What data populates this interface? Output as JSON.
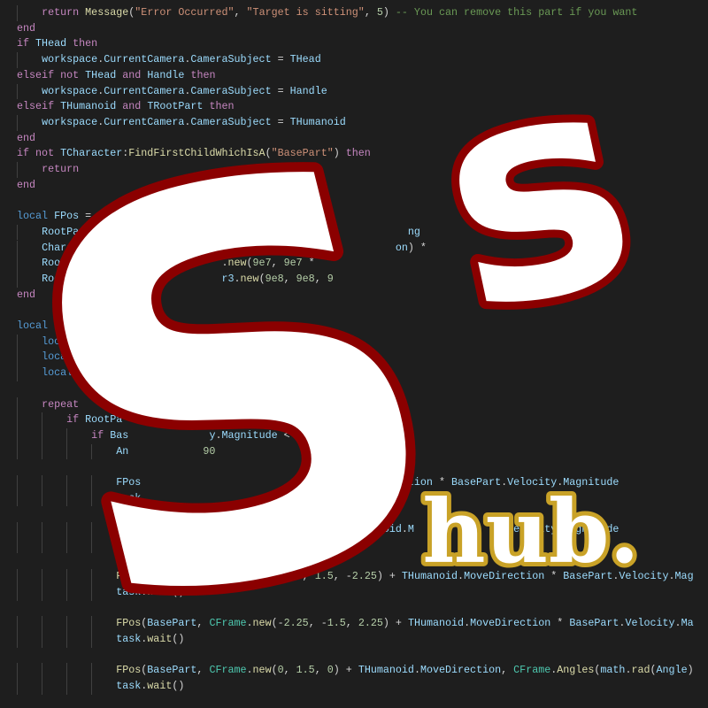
{
  "editor": {
    "lines": [
      "    return Message(\"Error Occurred\", \"Target is sitting\", 5) -- You can remove this part if you want",
      "end",
      "if THead then",
      "    workspace.CurrentCamera.CameraSubject = THead",
      "elseif not THead and Handle then",
      "    workspace.CurrentCamera.CameraSubject = Handle",
      "elseif THumanoid and TRootPart then",
      "    workspace.CurrentCamera.CameraSubject = THumanoid",
      "end",
      "if not TCharacter:FindFirstChildWhichIsA(\"BasePart\") then",
      "    return",
      "end",
      "",
      "local FPos = function(",
      "    RootPart.CFrame                                            ng",
      "    Character:SetP                                           on) *",
      "    RootPart.Veloc               .new(9e7, 9e7 *",
      "    RootPart.RotV                r3.new(9e8, 9e8, 9",
      "end",
      "",
      "local SFBasePart =",
      "    local TimeToWait",
      "    local Time = tick(",
      "    local Angle = 0",
      "",
      "    repeat",
      "        if RootPa          noid then",
      "            if Bas             y.Magnitude < 50 then",
      "                An            90",
      "",
      "                FPos                                 .MoveDirection * BasePart.Velocity.Magnitude",
      "                task",
      "",
      "                FPos(           CF                   THumanoid.M                elocity.Magnitude",
      "                task.wait()",
      "",
      "                FPos(BasePart, CFrame.new(2.25, 1.5, -2.25) + THumanoid.MoveDirection * BasePart.Velocity.Mag",
      "                task.wait()",
      "",
      "                FPos(BasePart, CFrame.new(-2.25, -1.5, 2.25) + THumanoid.MoveDirection * BasePart.Velocity.Ma",
      "                task.wait()",
      "",
      "                FPos(BasePart, CFrame.new(0, 1.5, 0) + THumanoid.MoveDirection, CFrame.Angles(math.rad(Angle)",
      "                task.wait()"
    ]
  },
  "logo": {
    "big_letter": "S",
    "small_letter": "s",
    "wordmark": "hub.",
    "colors": {
      "fill": "#ffffff",
      "outline": "#8b0000",
      "wordmark_outline": "#c9a227"
    }
  }
}
